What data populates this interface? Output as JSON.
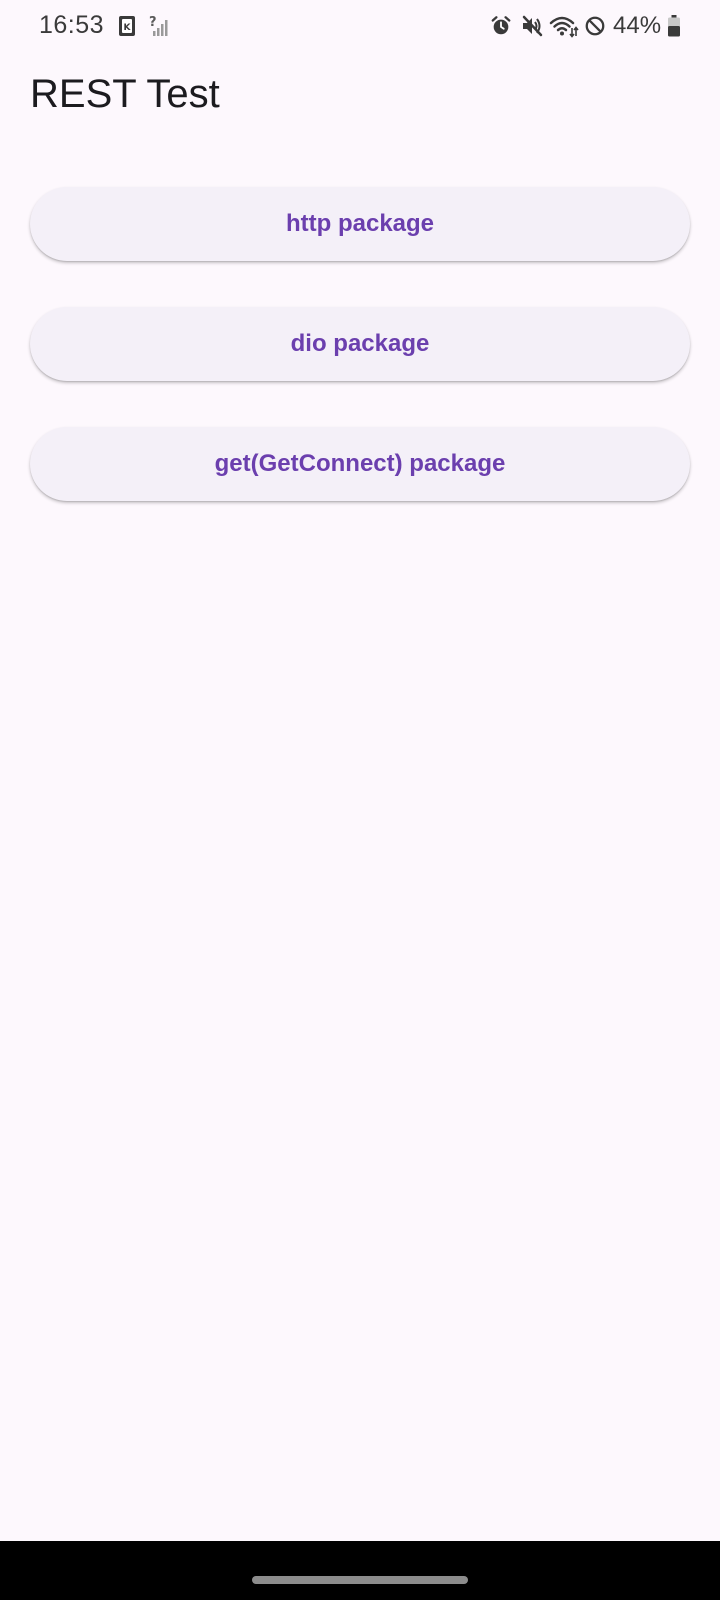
{
  "status_bar": {
    "time": "16:53",
    "battery_percent": "44%",
    "icons": [
      "k-notification-icon",
      "no-sim-signal-icon",
      "alarm-icon",
      "mute-icon",
      "wifi-icon",
      "do-not-disturb-icon",
      "battery-icon"
    ]
  },
  "app_bar": {
    "title": "REST Test"
  },
  "buttons": [
    {
      "label": "http package"
    },
    {
      "label": "dio package"
    },
    {
      "label": "get(GetConnect) package"
    }
  ],
  "colors": {
    "background": "#fdf8fd",
    "button_background": "#f4f0f8",
    "button_text": "#6b3fae"
  }
}
